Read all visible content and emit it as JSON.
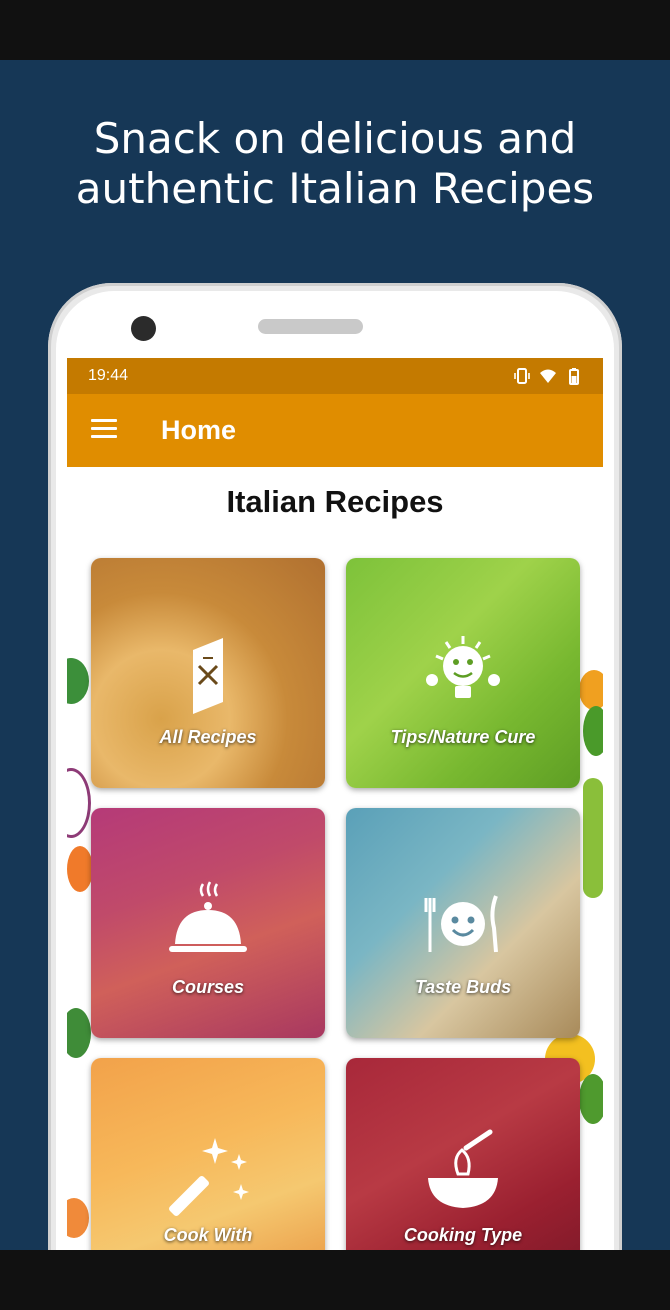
{
  "promo": {
    "line1": "Snack on delicious and",
    "line2": "authentic Italian Recipes"
  },
  "status_bar": {
    "time": "19:44",
    "icons": [
      "vibrate-icon",
      "wifi-icon",
      "battery-icon"
    ]
  },
  "app_bar": {
    "menu_icon": "hamburger-menu-icon",
    "title": "Home"
  },
  "main": {
    "title": "Italian Recipes",
    "tiles": [
      {
        "label": "All Recipes",
        "icon": "recipe-book-icon"
      },
      {
        "label": "Tips/Nature Cure",
        "icon": "bulb-character-icon"
      },
      {
        "label": "Courses",
        "icon": "cloche-icon"
      },
      {
        "label": "Taste Buds",
        "icon": "smiley-cutlery-icon"
      },
      {
        "label": "Cook With",
        "icon": "magic-wand-icon"
      },
      {
        "label": "Cooking Type",
        "icon": "whisk-bowl-icon"
      }
    ]
  },
  "colors": {
    "banner": "#163756",
    "status_bar": "#c47a00",
    "app_bar": "#e08d00"
  }
}
